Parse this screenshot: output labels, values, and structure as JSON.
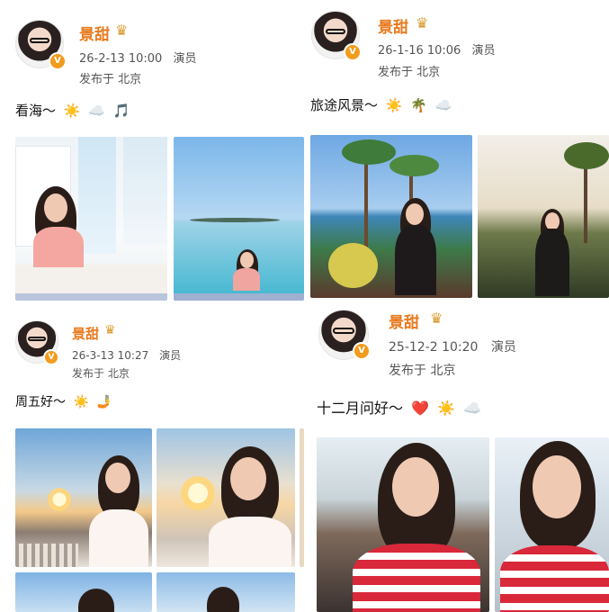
{
  "posts": [
    {
      "username": "景甜",
      "crown_icon": "crown-icon",
      "verified_badge": "V",
      "timestamp": "26-2-13 10:00",
      "role": "演员",
      "location": "发布于 北京",
      "text": "看海～",
      "emojis": [
        "☀️",
        "☁️",
        "🎵"
      ]
    },
    {
      "username": "景甜",
      "crown_icon": "crown-icon",
      "verified_badge": "V",
      "timestamp": "26-1-16 10:06",
      "role": "演员",
      "location": "发布于 北京",
      "text": "旅途风景～",
      "emojis": [
        "☀️",
        "🌴",
        "☁️"
      ]
    },
    {
      "username": "景甜",
      "crown_icon": "crown-icon",
      "verified_badge": "V",
      "timestamp": "26-3-13 10:27",
      "role": "演员",
      "location": "发布于 北京",
      "text": "周五好～",
      "emojis": [
        "☀️",
        "🤳"
      ]
    },
    {
      "username": "景甜",
      "crown_icon": "crown-icon",
      "verified_badge": "V",
      "timestamp": "25-12-2 10:20",
      "role": "演员",
      "location": "发布于 北京",
      "text": "十二月问好～",
      "emojis": [
        "❤️",
        "☀️",
        "☁️"
      ]
    }
  ],
  "colors": {
    "username": "#e8791c",
    "badge": "#f29b1c",
    "meta_text": "#555555",
    "sky_blue": "#8ec6ee",
    "sea_blue": "#5fc2db",
    "sunset": "#f7c98a",
    "stripe_red": "#d8283a"
  }
}
